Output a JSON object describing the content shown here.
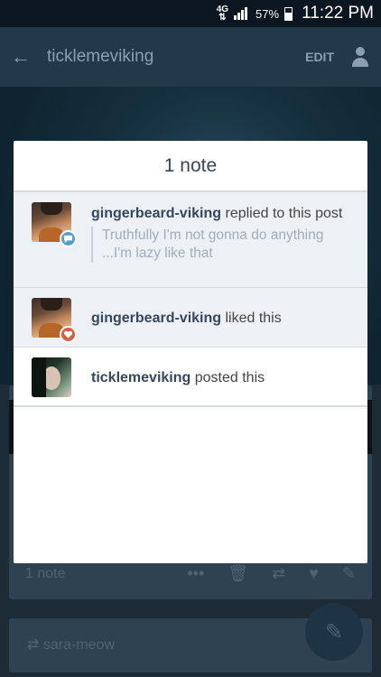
{
  "status_bar": {
    "network": "4G",
    "battery_percent": "57%",
    "time": "11:22 PM"
  },
  "app_bar": {
    "title": "ticklemeviking",
    "edit_label": "EDIT"
  },
  "background_post": {
    "notes_count": "1 note",
    "reblog_user": "sara-meow"
  },
  "notes_modal": {
    "title": "1 note",
    "notes": [
      {
        "username": "gingerbeard-viking",
        "action": "replied to this post",
        "reply_text": "Truthfully I'm not gonna do anything ...I'm lazy like that",
        "badge": "reply"
      },
      {
        "username": "gingerbeard-viking",
        "action": "liked this",
        "badge": "like"
      },
      {
        "username": "ticklemeviking",
        "action": "posted this"
      }
    ]
  },
  "colors": {
    "reply_badge": "#529ecc",
    "like_badge": "#d95e40",
    "username": "#36465d",
    "highlight_row": "#edf1f5"
  }
}
